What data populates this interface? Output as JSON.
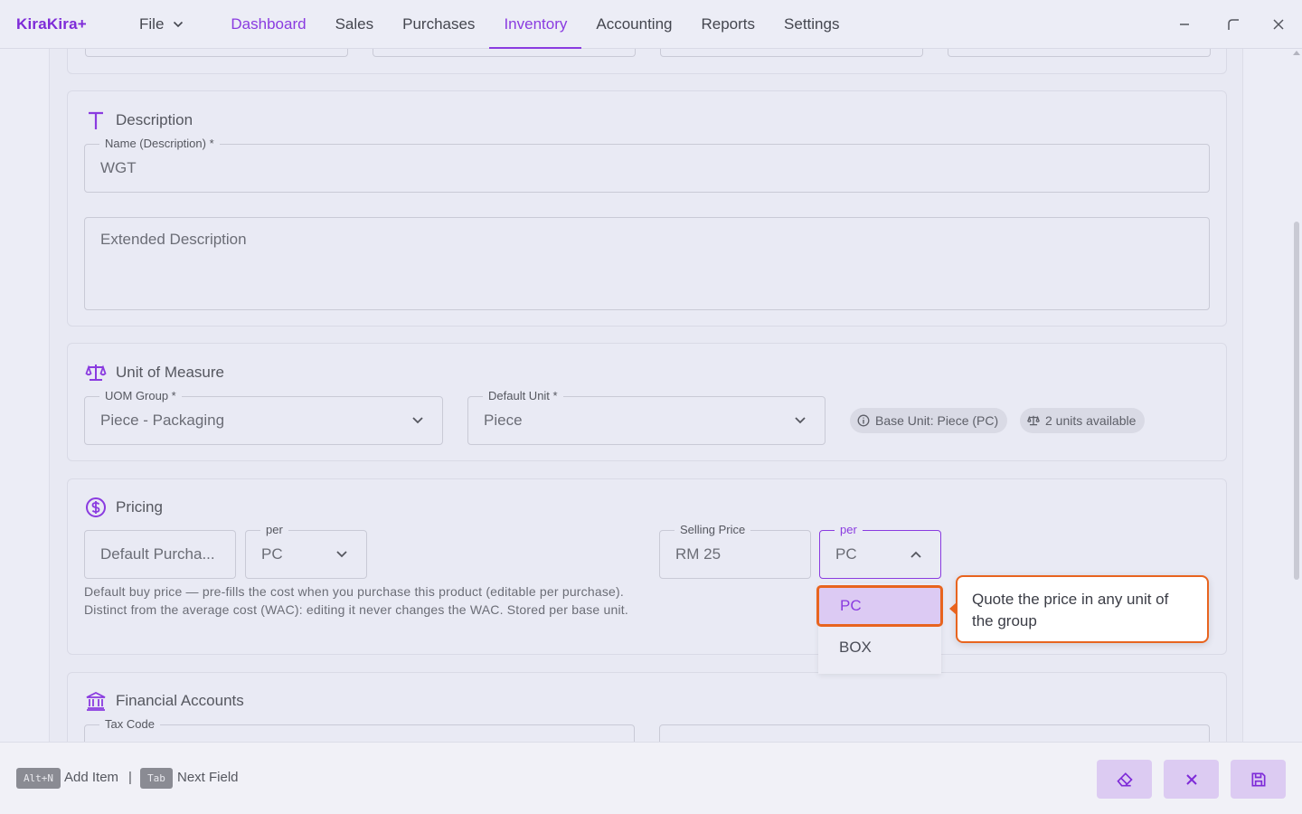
{
  "app": {
    "name": "KiraKira+"
  },
  "nav": {
    "file": "File",
    "items": [
      "Dashboard",
      "Sales",
      "Purchases",
      "Inventory",
      "Accounting",
      "Reports",
      "Settings"
    ]
  },
  "description": {
    "title": "Description",
    "name_label": "Name (Description) *",
    "name_value": "WGT",
    "extended_placeholder": "Extended Description"
  },
  "uom": {
    "title": "Unit of Measure",
    "group_label": "UOM Group *",
    "group_value": "Piece - Packaging",
    "default_label": "Default Unit *",
    "default_value": "Piece",
    "chip_base": "Base Unit: Piece (PC)",
    "chip_units": "2 units available"
  },
  "pricing": {
    "title": "Pricing",
    "purchase_placeholder": "Default Purcha...",
    "per_label": "per",
    "purchase_unit": "PC",
    "help": "Default buy price — pre-fills the cost when you purchase this product (editable per purchase). Distinct from the average cost (WAC): editing it never changes the WAC. Stored per base unit.",
    "selling_label": "Selling Price",
    "selling_value": "RM  25",
    "selling_unit": "PC",
    "options": [
      "PC",
      "BOX"
    ],
    "tooltip": "Quote the price in any unit of the group"
  },
  "financial": {
    "title": "Financial Accounts",
    "tax_label": "Tax Code"
  },
  "footer": {
    "key1": "Alt+N",
    "key1_text": "Add Item",
    "separator": "|",
    "key2": "Tab",
    "key2_text": "Next Field"
  },
  "colors": {
    "accent": "#8a3be0",
    "highlight": "#e8641f"
  }
}
